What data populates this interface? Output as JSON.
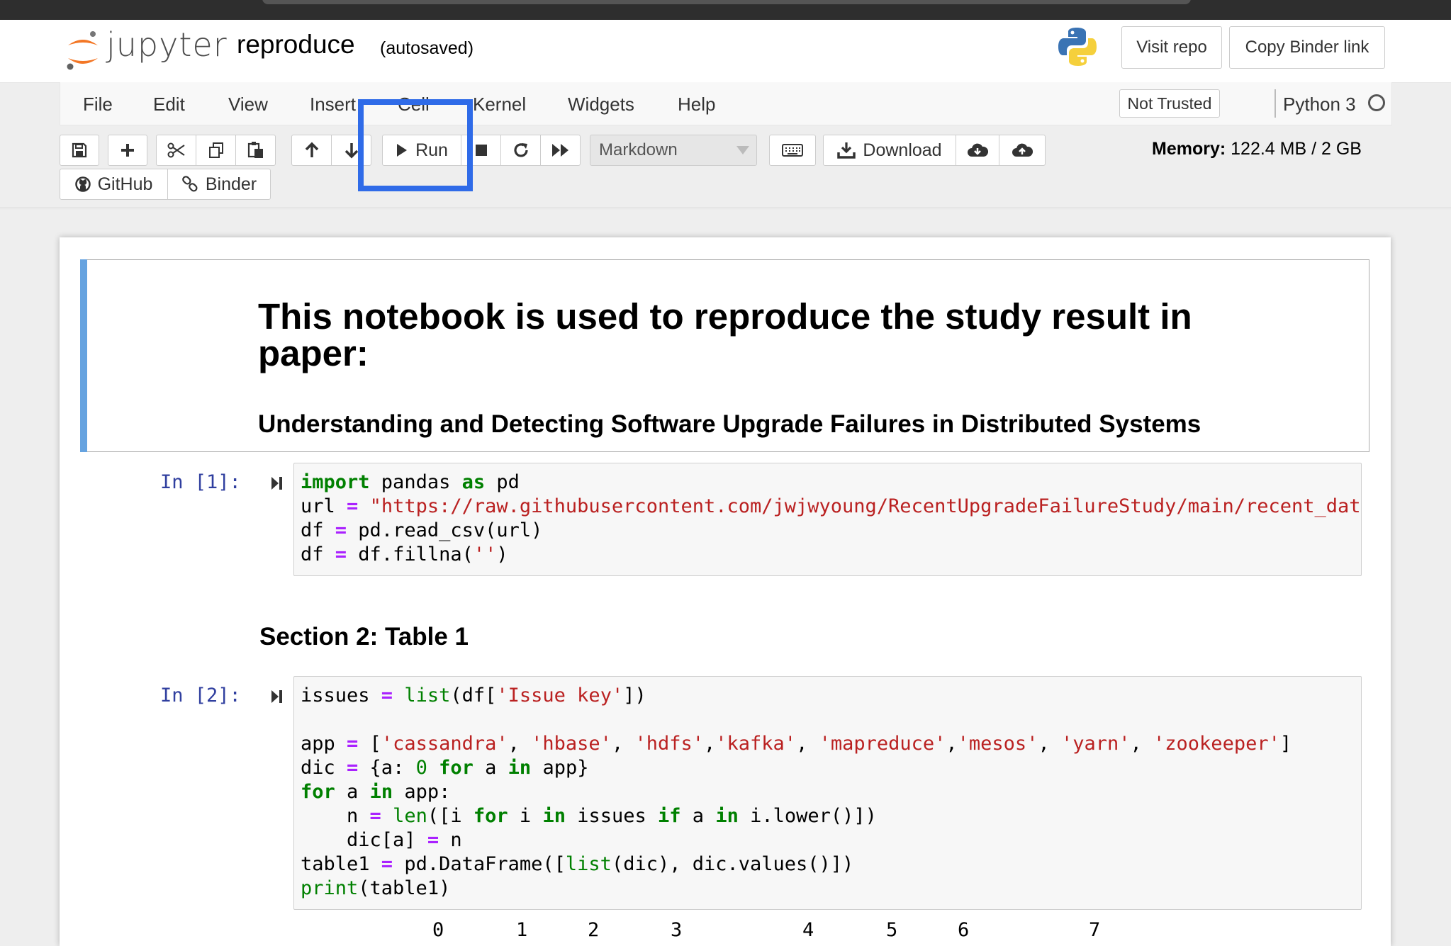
{
  "header": {
    "logo_text": "jupyter",
    "notebook_name": "reproduce",
    "autosave": "(autosaved)",
    "visit_repo": "Visit repo",
    "copy_binder": "Copy Binder link"
  },
  "menu": {
    "items": [
      "File",
      "Edit",
      "View",
      "Insert",
      "Cell",
      "Kernel",
      "Widgets",
      "Help"
    ],
    "trusted": "Not Trusted",
    "kernel": "Python 3"
  },
  "toolbar": {
    "run": "Run",
    "cell_type": "Markdown",
    "download": "Download",
    "github": "GitHub",
    "binder": "Binder",
    "memory_label": "Memory:",
    "memory_value": "122.4 MB / 2 GB"
  },
  "notebook": {
    "md_title": "This notebook is used to reproduce the study result in paper:",
    "md_subtitle": "Understanding and Detecting Software Upgrade Failures in Distributed Systems",
    "cell1_prompt": "In [1]:",
    "section_heading": "Section 2: Table 1",
    "cell2_prompt": "In [2]:",
    "output_cols": [
      "0",
      "1",
      "2",
      "3",
      "4",
      "5",
      "6",
      "7"
    ]
  }
}
